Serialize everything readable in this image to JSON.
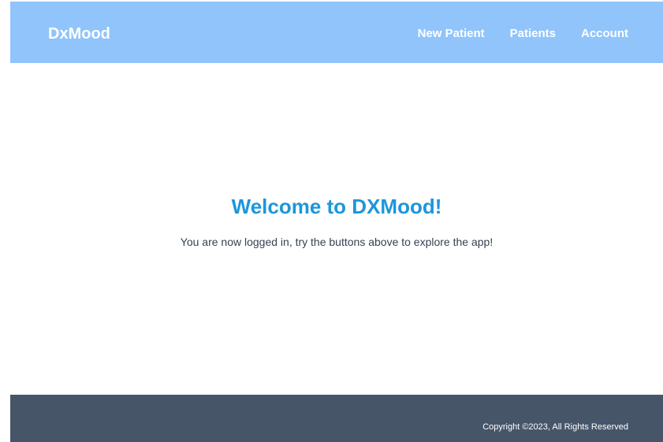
{
  "app": {
    "brand": "DxMood"
  },
  "nav": {
    "links": [
      {
        "label": "New Patient"
      },
      {
        "label": "Patients"
      },
      {
        "label": "Account"
      }
    ]
  },
  "main": {
    "title": "Welcome to DXMood!",
    "message": "You are now logged in, try the buttons above to explore the app!"
  },
  "footer": {
    "copyright": "Copyright ©2023, All Rights Reserved"
  },
  "colors": {
    "navbar": "#90c4fb",
    "title": "#1d96db",
    "footer": "#475569"
  }
}
